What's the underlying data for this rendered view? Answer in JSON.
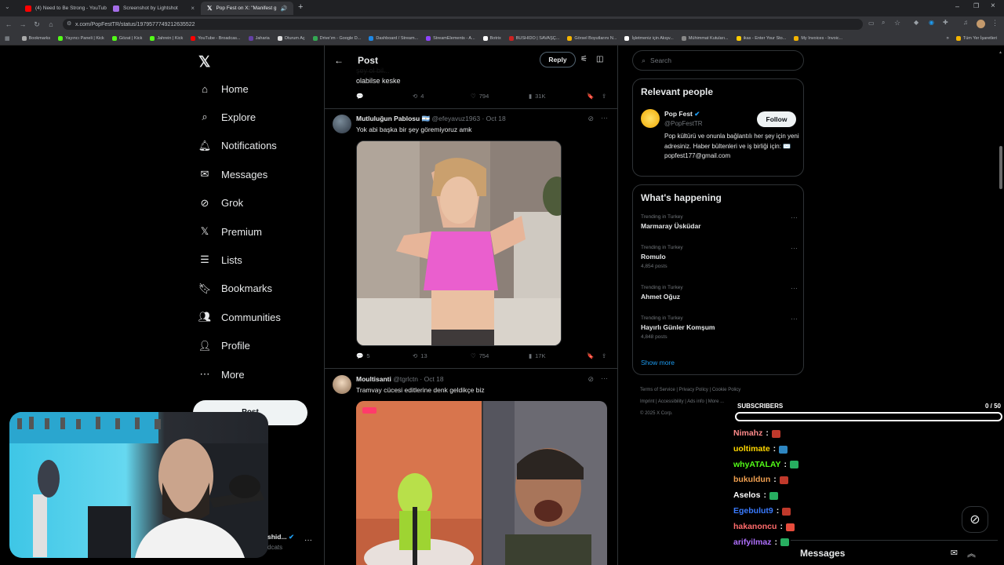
{
  "browser": {
    "tabs": [
      {
        "label": "(4) Need to Be Strong - YouTub",
        "color": "#ff0000",
        "active": false
      },
      {
        "label": "Screenshot by Lightshot",
        "color": "#a56ee8",
        "active": false
      },
      {
        "label": "Pop Fest on X: \"Manifest g",
        "color": "#ffffff",
        "active": true
      }
    ],
    "url": "x.com/PopFestTR/status/1979577749212635522",
    "bookmarks": [
      {
        "label": "Bookmarks",
        "color": "#aaaaaa"
      },
      {
        "label": "Yayıncı Paneli | Kick",
        "color": "#53fc18"
      },
      {
        "label": "Gözat | Kick",
        "color": "#53fc18"
      },
      {
        "label": "Jahrein | Kick",
        "color": "#53fc18"
      },
      {
        "label": "YouTube - Broadcas...",
        "color": "#ff0000"
      },
      {
        "label": "Jaharia",
        "color": "#6441a5"
      },
      {
        "label": "Oturum Aç",
        "color": "#dddddd"
      },
      {
        "label": "Drive'ım - Google D...",
        "color": "#34a853"
      },
      {
        "label": "Dashboard / Stream...",
        "color": "#1e88e5"
      },
      {
        "label": "StreamElements - A...",
        "color": "#8e44ff"
      },
      {
        "label": "Botrix",
        "color": "#ffffff"
      },
      {
        "label": "BUSHIDO | SAVAŞÇ...",
        "color": "#cc2222"
      },
      {
        "label": "Görsel Boyutlarını N...",
        "color": "#f4b400"
      },
      {
        "label": "İşletmeniz için Akışv...",
        "color": "#ffffff"
      },
      {
        "label": "Mühimmat Kutuları...",
        "color": "#888888"
      },
      {
        "label": "ikas - Enter Your Sto...",
        "color": "#ffcc00"
      },
      {
        "label": "My Invoices - Invoic...",
        "color": "#f4b400"
      }
    ],
    "bookmarks_right": "Tüm Yer İşaretleri"
  },
  "sidebar": {
    "items": [
      {
        "label": "Home",
        "icon": "home-icon"
      },
      {
        "label": "Explore",
        "icon": "search-icon"
      },
      {
        "label": "Notifications",
        "icon": "bell-icon"
      },
      {
        "label": "Messages",
        "icon": "envelope-icon"
      },
      {
        "label": "Grok",
        "icon": "grok-icon"
      },
      {
        "label": "Premium",
        "icon": "x-logo-icon"
      },
      {
        "label": "Lists",
        "icon": "list-icon"
      },
      {
        "label": "Bookmarks",
        "icon": "bookmark-icon"
      },
      {
        "label": "Communities",
        "icon": "communities-icon"
      },
      {
        "label": "Profile",
        "icon": "person-icon"
      },
      {
        "label": "More",
        "icon": "more-circle-icon"
      }
    ],
    "post_label": "Post",
    "account_name": "shid...",
    "account_handle": "dcats"
  },
  "post_header": {
    "title": "Post",
    "reply_label": "Reply"
  },
  "prev_tweet": {
    "text": "olabilse keske",
    "stats": {
      "replies": "",
      "retweets": "4",
      "likes": "794",
      "views": "31K"
    }
  },
  "tweets": [
    {
      "name": "Mutluluğun Pablosu 🇦🇷",
      "handle": "@efeyavuz1963",
      "date": "Oct 18",
      "text": "Yok abi başka bir şey göremiyoruz amk",
      "stats": {
        "replies": "5",
        "retweets": "13",
        "likes": "754",
        "views": "17K"
      }
    },
    {
      "name": "Moultisanti",
      "handle": "@tgrlctn",
      "date": "Oct 18",
      "text": "Tramvay cücesi editlerine denk geldikçe biz",
      "stats": {
        "replies": "",
        "retweets": "",
        "likes": "",
        "views": ""
      }
    }
  ],
  "right": {
    "search_placeholder": "Search",
    "relevant_title": "Relevant people",
    "person": {
      "name": "Pop Fest",
      "handle": "@PopFestTR",
      "follow": "Follow",
      "bio": "Pop kültürü ve onunla bağlantılı her şey için yeni adresiniz. Haber bültenleri ve iş birliği için: ✉️ popfest177@gmail.com"
    },
    "happening_title": "What's happening",
    "trends": [
      {
        "category": "Trending in Turkey",
        "name": "Marmaray Üsküdar",
        "count": ""
      },
      {
        "category": "Trending in Turkey",
        "name": "Romulo",
        "count": "4,854 posts"
      },
      {
        "category": "Trending in Turkey",
        "name": "Ahmet Oğuz",
        "count": ""
      },
      {
        "category": "Trending in Turkey",
        "name": "Hayırlı Günler Komşum",
        "count": "4,848 posts"
      }
    ],
    "show_more": "Show more",
    "footer_links": [
      "Terms of Service",
      "Privacy Policy",
      "Cookie Policy",
      "Imprint",
      "Accessibility",
      "Ads info",
      "More ..."
    ],
    "copyright": "© 2025 X Corp."
  },
  "overlay": {
    "subs_label": "SUBSCRIBERS",
    "subs_count": "0 / 50",
    "subs_progress": 0,
    "chat": [
      {
        "user": "Nimahz",
        "color": "#ff8a8a",
        "emote": "#c0392b"
      },
      {
        "user": "uoltimate",
        "color": "#ffd700",
        "emote": "#2e86c1"
      },
      {
        "user": "whyATALAY",
        "color": "#53fc18",
        "emote": "#27ae60"
      },
      {
        "user": "bukuldun",
        "color": "#f0a050",
        "emote": "#c0392b"
      },
      {
        "user": "Aselos",
        "color": "#ffffff",
        "emote": "#27ae60"
      },
      {
        "user": "Egebulut9",
        "color": "#3a7bff",
        "emote": "#c0392b"
      },
      {
        "user": "hakanoncu",
        "color": "#ff6b6b",
        "emote": "#e74c3c"
      },
      {
        "user": "arifyilmaz",
        "color": "#b070ff",
        "emote": "#27ae60"
      }
    ]
  },
  "messages_bar": {
    "label": "Messages"
  },
  "colors": {
    "accent": "#1d9bf0",
    "border": "#2f3336",
    "muted": "#71767b"
  }
}
